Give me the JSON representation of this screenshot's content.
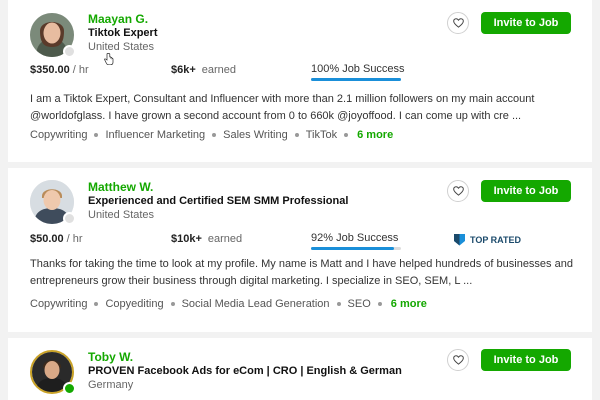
{
  "freelancers": [
    {
      "name": "Maayan G.",
      "title": "Tiktok Expert",
      "location": "United States",
      "rate": "$350.00",
      "rate_unit": "/ hr",
      "earned_amount": "$6k+",
      "earned_label": "earned",
      "job_success_label": "100% Job Success",
      "job_success_pct": 100,
      "badge": "",
      "online": false,
      "description": "I am a Tiktok Expert, Consultant and Influencer with more than 2.1 million followers on my main account @worldofglass. I have grown a second account from 0 to 660k @joyoffood. I can come up with cre ...",
      "skills": [
        "Copywriting",
        "Influencer Marketing",
        "Sales Writing",
        "TikTok"
      ],
      "more_skills": "6 more",
      "invite_label": "Invite to Job"
    },
    {
      "name": "Matthew W.",
      "title": "Experienced and Certified SEM SMM Professional",
      "location": "United States",
      "rate": "$50.00",
      "rate_unit": "/ hr",
      "earned_amount": "$10k+",
      "earned_label": "earned",
      "job_success_label": "92% Job Success",
      "job_success_pct": 92,
      "badge": "TOP RATED",
      "online": false,
      "description": "Thanks for taking the time to look at my profile. My name is Matt and I have helped hundreds of businesses and entrepreneurs grow their business through digital marketing. I specialize in SEO, SEM, L ...",
      "skills": [
        "Copywriting",
        "Copyediting",
        "Social Media Lead Generation",
        "SEO"
      ],
      "more_skills": "6 more",
      "invite_label": "Invite to Job"
    },
    {
      "name": "Toby W.",
      "title": "PROVEN Facebook Ads for eCom | CRO | English & German",
      "location": "Germany",
      "online": true,
      "invite_label": "Invite to Job"
    }
  ],
  "colors": {
    "brand_green": "#14a800",
    "jss_blue": "#1a8fd9",
    "badge_navy": "#1b4a6b"
  },
  "icons": {
    "save": "heart-icon",
    "top_rated": "top-rated-badge-icon",
    "pointer": "hand-pointer-icon"
  }
}
